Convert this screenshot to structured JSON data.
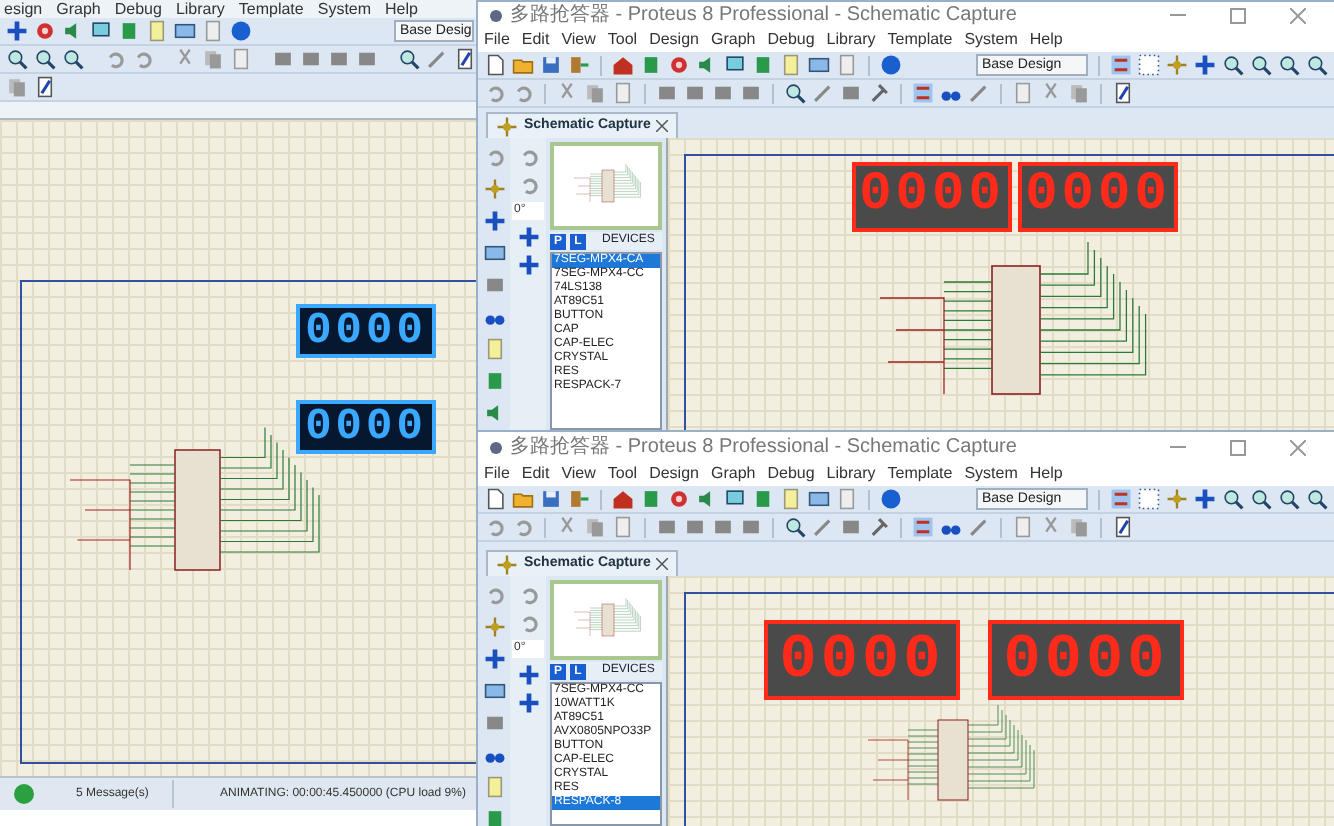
{
  "back_window": {
    "menu": [
      "esign",
      "Graph",
      "Debug",
      "Library",
      "Template",
      "System",
      "Help"
    ],
    "design_select": "Base Desig",
    "displays": [
      {
        "digits": "0000",
        "color": "#3aa8ff"
      },
      {
        "digits": "0000",
        "color": "#3aa8ff"
      }
    ],
    "status_bar": {
      "messages": "5 Message(s)",
      "animation": "ANIMATING: 00:00:45.450000 (CPU load 9%)"
    }
  },
  "windows": [
    {
      "title": "多路抢答器 - Proteus 8 Professional - Schematic Capture",
      "menu": [
        "File",
        "Edit",
        "View",
        "Tool",
        "Design",
        "Graph",
        "Debug",
        "Library",
        "Template",
        "System",
        "Help"
      ],
      "design_select": "Base Design",
      "tab": "Schematic Capture",
      "angle": "0°",
      "picker": {
        "p": "P",
        "l": "L",
        "header": "DEVICES"
      },
      "devices": [
        {
          "name": "7SEG-MPX4-CA",
          "selected": true
        },
        {
          "name": "7SEG-MPX4-CC",
          "selected": false
        },
        {
          "name": "74LS138",
          "selected": false
        },
        {
          "name": "AT89C51",
          "selected": false
        },
        {
          "name": "BUTTON",
          "selected": false
        },
        {
          "name": "CAP",
          "selected": false
        },
        {
          "name": "CAP-ELEC",
          "selected": false
        },
        {
          "name": "CRYSTAL",
          "selected": false
        },
        {
          "name": "RES",
          "selected": false
        },
        {
          "name": "RESPACK-7",
          "selected": false
        }
      ],
      "displays": [
        {
          "digits": "0000",
          "color": "#ff2a1a"
        },
        {
          "digits": "0000",
          "color": "#ff2a1a"
        }
      ]
    },
    {
      "title": "多路抢答器 - Proteus 8 Professional - Schematic Capture",
      "menu": [
        "File",
        "Edit",
        "View",
        "Tool",
        "Design",
        "Graph",
        "Debug",
        "Library",
        "Template",
        "System",
        "Help"
      ],
      "design_select": "Base Design",
      "tab": "Schematic Capture",
      "angle": "0°",
      "picker": {
        "p": "P",
        "l": "L",
        "header": "DEVICES"
      },
      "devices": [
        {
          "name": "7SEG-MPX4-CC",
          "selected": false
        },
        {
          "name": "10WATT1K",
          "selected": false
        },
        {
          "name": "AT89C51",
          "selected": false
        },
        {
          "name": "AVX0805NPO33P",
          "selected": false
        },
        {
          "name": "BUTTON",
          "selected": false
        },
        {
          "name": "CAP-ELEC",
          "selected": false
        },
        {
          "name": "CRYSTAL",
          "selected": false
        },
        {
          "name": "RES",
          "selected": false
        },
        {
          "name": "RESPACK-8",
          "selected": true
        }
      ],
      "displays": [
        {
          "digits": "0000",
          "color": "#ff2a1a"
        },
        {
          "digits": "0000",
          "color": "#ff2a1a"
        }
      ]
    }
  ]
}
